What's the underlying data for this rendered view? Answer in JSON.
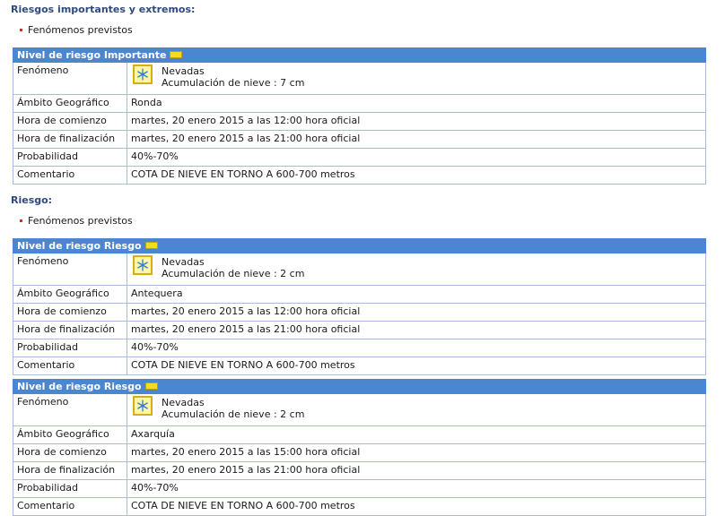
{
  "sections": [
    {
      "title": "Riesgos importantes y extremos:",
      "bullet": "Fenómenos previstos",
      "tables": [
        {
          "header": "Nivel de riesgo Importante",
          "phenomenon_label": "Fenómeno",
          "phenomenon_name": "Nevadas",
          "phenomenon_detail": "Acumulación de nieve : 7 cm",
          "rows": [
            {
              "label": "Ámbito Geográfico",
              "value": "Ronda"
            },
            {
              "label": "Hora de comienzo",
              "value": "martes, 20 enero 2015 a las 12:00 hora oficial"
            },
            {
              "label": "Hora de finalización",
              "value": "martes, 20 enero 2015 a las 21:00 hora oficial"
            },
            {
              "label": "Probabilidad",
              "value": "40%-70%"
            },
            {
              "label": "Comentario",
              "value": "COTA DE NIEVE EN TORNO A 600-700 metros"
            }
          ]
        }
      ]
    },
    {
      "title": "Riesgo:",
      "bullet": "Fenómenos previstos",
      "tables": [
        {
          "header": "Nivel de riesgo Riesgo",
          "phenomenon_label": "Fenómeno",
          "phenomenon_name": "Nevadas",
          "phenomenon_detail": "Acumulación de nieve : 2 cm",
          "rows": [
            {
              "label": "Ámbito Geográfico",
              "value": "Antequera"
            },
            {
              "label": "Hora de comienzo",
              "value": "martes, 20 enero 2015 a las 12:00 hora oficial"
            },
            {
              "label": "Hora de finalización",
              "value": "martes, 20 enero 2015 a las 21:00 hora oficial"
            },
            {
              "label": "Probabilidad",
              "value": "40%-70%"
            },
            {
              "label": "Comentario",
              "value": "COTA DE NIEVE EN TORNO A 600-700 metros"
            }
          ]
        },
        {
          "header": "Nivel de riesgo Riesgo",
          "phenomenon_label": "Fenómeno",
          "phenomenon_name": "Nevadas",
          "phenomenon_detail": "Acumulación de nieve : 2 cm",
          "rows": [
            {
              "label": "Ámbito Geográfico",
              "value": "Axarquía"
            },
            {
              "label": "Hora de comienzo",
              "value": "martes, 20 enero 2015 a las 15:00 hora oficial"
            },
            {
              "label": "Hora de finalización",
              "value": "martes, 20 enero 2015 a las 21:00 hora oficial"
            },
            {
              "label": "Probabilidad",
              "value": "40%-70%"
            },
            {
              "label": "Comentario",
              "value": "COTA DE NIEVE EN TORNO A 600-700 metros"
            }
          ]
        }
      ]
    }
  ],
  "icons": {
    "phenomenon": "snowflake-icon",
    "level_badge": "yellow-level-badge",
    "level_color": "#f2de1e",
    "header_color": "#4b86d0",
    "title_color": "#2f4a7d"
  }
}
